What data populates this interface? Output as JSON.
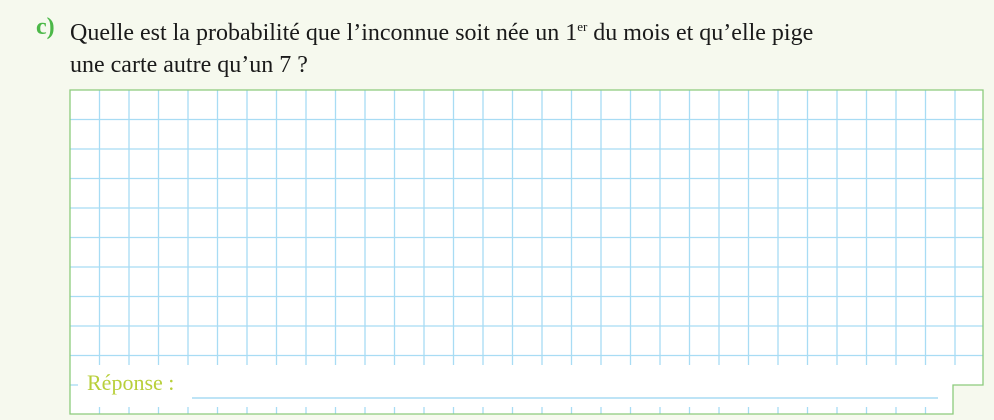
{
  "question": {
    "label": "c)",
    "text_before_sup": "Quelle est la probabilité que l’inconnue soit née un 1",
    "sup": "er",
    "text_after_sup": " du mois et qu’elle pige",
    "line2": "une carte autre qu’un 7 ?"
  },
  "answer": {
    "label": "Réponse :",
    "value": ""
  },
  "colors": {
    "label": "#4cb848",
    "answer_label": "#b8cf3a",
    "grid": "#a8dcf4",
    "border": "#8ccb7c"
  }
}
